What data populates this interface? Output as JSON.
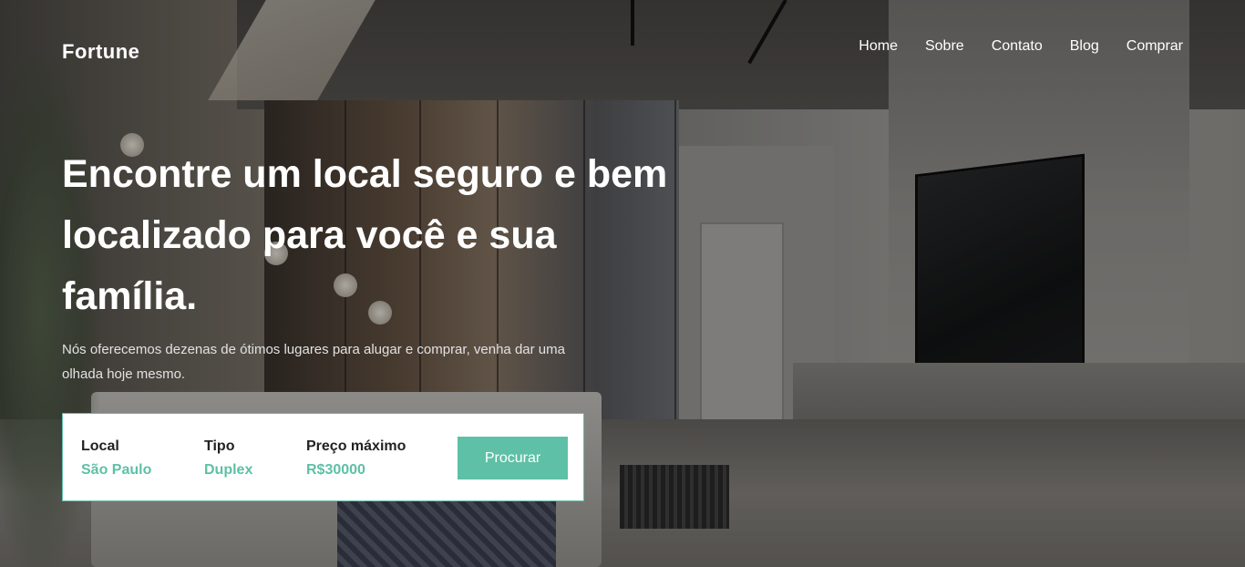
{
  "brand": {
    "name": "Fortune"
  },
  "nav": {
    "items": [
      "Home",
      "Sobre",
      "Contato",
      "Blog",
      "Comprar"
    ]
  },
  "hero": {
    "headline": "Encontre um local seguro e bem localizado para você e sua família.",
    "subtitle": "Nós oferecemos dezenas de ótimos lugares para alugar e comprar, venha dar uma olhada hoje mesmo."
  },
  "search": {
    "location_label": "Local",
    "location_value": "São Paulo",
    "type_label": "Tipo",
    "type_value": "Duplex",
    "price_label": "Preço máximo",
    "price_value": "R$30000",
    "button_label": "Procurar"
  },
  "colors": {
    "accent": "#5ec0a6",
    "text_light": "#ffffff",
    "text_dark": "#222222"
  }
}
